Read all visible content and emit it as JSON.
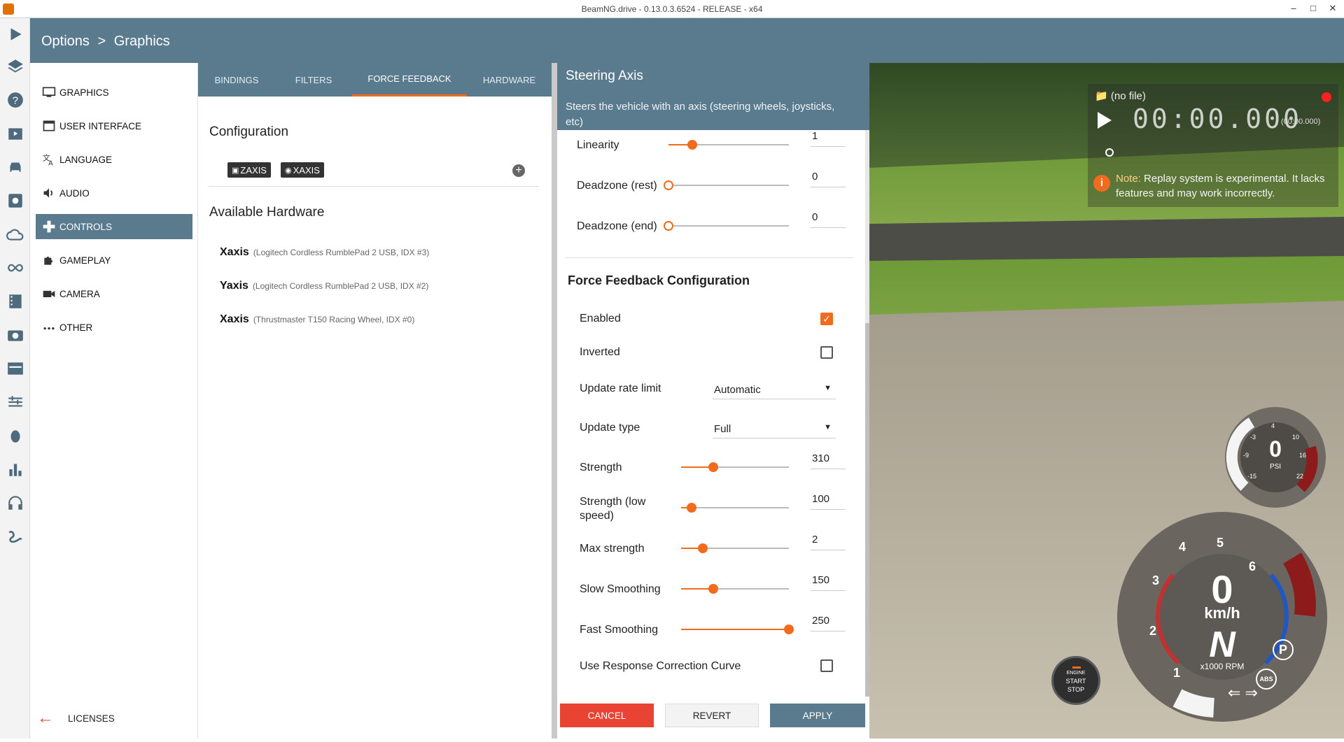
{
  "window": {
    "title": "BeamNG.drive - 0.13.0.3.6524 - RELEASE - x64"
  },
  "header": {
    "section": "Options",
    "separator": ">",
    "page": "Graphics"
  },
  "categories": [
    {
      "label": "GRAPHICS",
      "icon": "monitor-icon"
    },
    {
      "label": "USER INTERFACE",
      "icon": "window-icon"
    },
    {
      "label": "LANGUAGE",
      "icon": "translate-icon"
    },
    {
      "label": "AUDIO",
      "icon": "speaker-icon"
    },
    {
      "label": "CONTROLS",
      "icon": "gamepad-icon"
    },
    {
      "label": "GAMEPLAY",
      "icon": "puzzle-icon"
    },
    {
      "label": "CAMERA",
      "icon": "camera-icon"
    },
    {
      "label": "OTHER",
      "icon": "more-icon"
    }
  ],
  "licenses": {
    "label": "LICENSES"
  },
  "tabs": [
    "BINDINGS",
    "FILTERS",
    "FORCE FEEDBACK",
    "HARDWARE"
  ],
  "left": {
    "configuration_title": "Configuration",
    "bindings": [
      "ZAXIS",
      "XAXIS"
    ],
    "hardware_title": "Available Hardware",
    "hardware": [
      {
        "axis": "Xaxis",
        "device": "(Logitech Cordless RumblePad 2 USB, IDX #3)"
      },
      {
        "axis": "Yaxis",
        "device": "(Logitech Cordless RumblePad 2 USB, IDX #2)"
      },
      {
        "axis": "Xaxis",
        "device": "(Thrustmaster T150 Racing Wheel, IDX #0)"
      }
    ]
  },
  "right": {
    "title": "Steering Axis",
    "description": "Steers the vehicle with an axis (steering wheels, joysticks, etc)",
    "axis_settings": [
      {
        "label": "Linearity",
        "value": "1",
        "fraction": 0.2
      },
      {
        "label": "Deadzone (rest)",
        "value": "0",
        "fraction": 0.0
      },
      {
        "label": "Deadzone (end)",
        "value": "0",
        "fraction": 0.0
      }
    ],
    "ff_title": "Force Feedback Configuration",
    "enabled": {
      "label": "Enabled",
      "checked": true
    },
    "inverted": {
      "label": "Inverted",
      "checked": false
    },
    "update_rate": {
      "label": "Update rate limit",
      "value": "Automatic"
    },
    "update_type": {
      "label": "Update type",
      "value": "Full"
    },
    "ff_settings": [
      {
        "label": "Strength",
        "value": "310",
        "fraction": 0.3
      },
      {
        "label": "Strength (low speed)",
        "value": "100",
        "fraction": 0.1
      },
      {
        "label": "Max strength",
        "value": "2",
        "fraction": 0.2
      },
      {
        "label": "Slow Smoothing",
        "value": "150",
        "fraction": 0.3
      },
      {
        "label": "Fast Smoothing",
        "value": "250",
        "fraction": 1.0
      }
    ],
    "response_curve": {
      "label": "Use Response Correction Curve",
      "checked": false
    }
  },
  "footer": {
    "cancel": "CANCEL",
    "revert": "REVERT",
    "apply": "APPLY"
  },
  "game": {
    "replay": {
      "file": "(no file)",
      "time": "00:00.000",
      "time_small": "(00:00.000)",
      "note_label": "Note:",
      "note_text": "Replay system is experimental. It lacks features and may work incorrectly."
    },
    "turbo": {
      "value": "0",
      "unit": "PSI",
      "ticks": [
        "-3",
        "4",
        "10",
        "-9",
        "16",
        "-15",
        "22"
      ]
    },
    "speedo": {
      "speed": "0",
      "unit": "km/h",
      "gear": "N",
      "rpm_unit": "x1000 RPM",
      "rpm_ticks": [
        "1",
        "2",
        "3",
        "4",
        "5",
        "6"
      ],
      "abs": "ABS",
      "park": "P"
    },
    "engine_button": {
      "line1": "ENGINE",
      "line2": "START",
      "line3": "STOP"
    }
  },
  "colors": {
    "header": "#5a7b8e",
    "accent": "#f26b1d",
    "cancel": "#e94334"
  }
}
